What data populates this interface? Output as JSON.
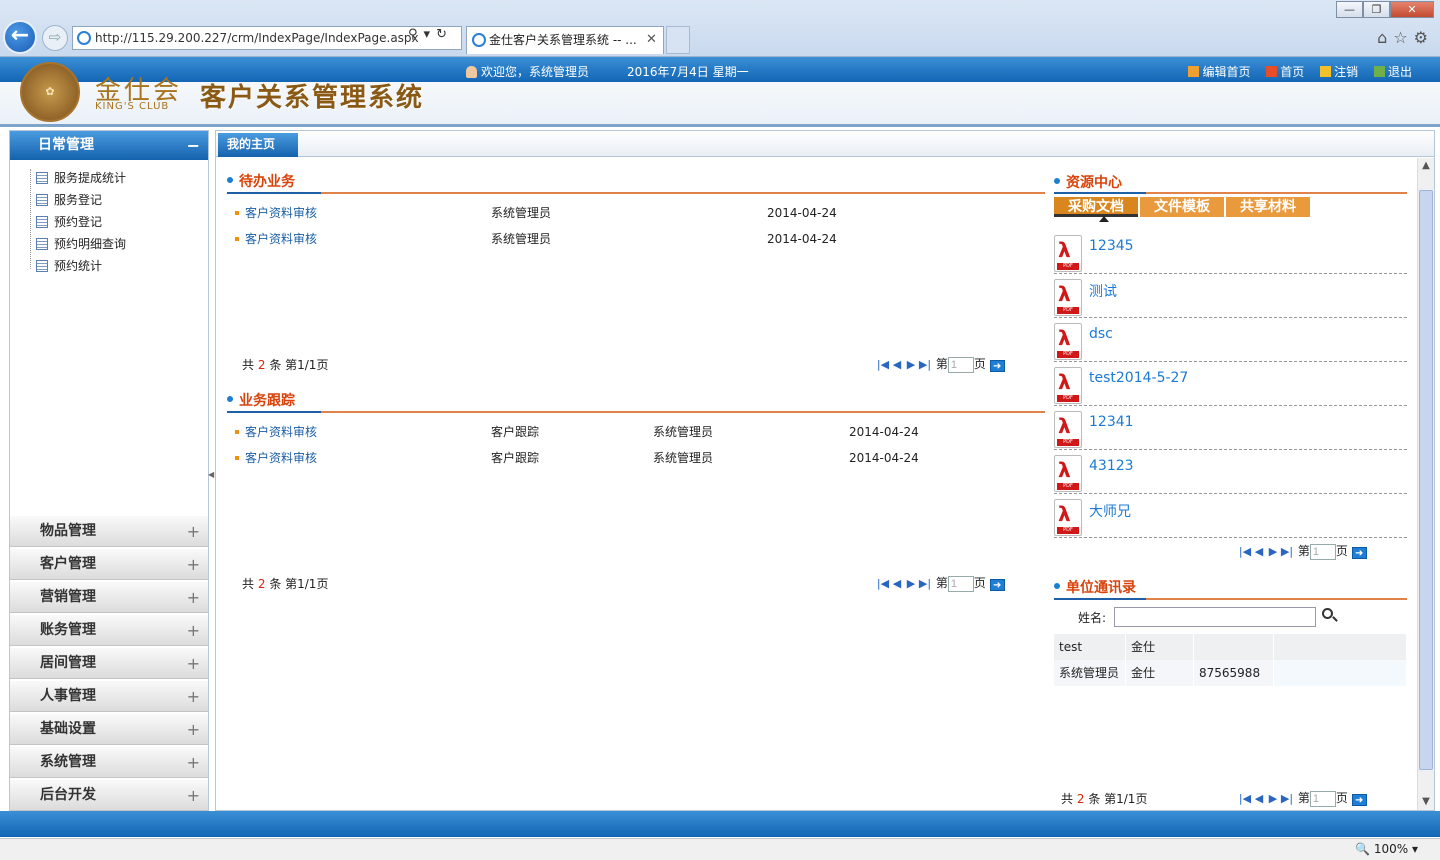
{
  "browser": {
    "url": "http://115.29.200.227/crm/IndexPage/IndexPage.aspx",
    "tab_title": "金仕客户关系管理系统 -- ...",
    "zoom": "100%"
  },
  "header": {
    "logo_cn": "金仕会",
    "logo_en": "KING'S CLUB",
    "system_title": "客户关系管理系统",
    "welcome": "欢迎您，系统管理员",
    "date": "2016年7月4日 星期一",
    "links": [
      "编辑首页",
      "首页",
      "注销",
      "退出"
    ]
  },
  "sidebar": {
    "open_section": "日常管理",
    "open_section_toggle": "−",
    "items": [
      "服务提成统计",
      "服务登记",
      "预约登记",
      "预约明细查询",
      "预约统计"
    ],
    "collapsed_sections": [
      "物品管理",
      "客户管理",
      "营销管理",
      "账务管理",
      "居间管理",
      "人事管理",
      "基础设置",
      "系统管理",
      "后台开发"
    ],
    "expand_symbol": "+"
  },
  "main": {
    "home_tab": "我的主页",
    "pending": {
      "title": "待办业务",
      "rows": [
        {
          "name": "客户资料审核",
          "user": "系统管理员",
          "date": "2014-04-24"
        },
        {
          "name": "客户资料审核",
          "user": "系统管理员",
          "date": "2014-04-24"
        }
      ],
      "pager": {
        "prefix": "共",
        "count": "2",
        "suffix": "条 第1/1页",
        "page_prefix": "第",
        "page_suffix": "页",
        "page_value": "1"
      }
    },
    "tracking": {
      "title": "业务跟踪",
      "rows": [
        {
          "name": "客户资料审核",
          "type": "客户跟踪",
          "user": "系统管理员",
          "date": "2014-04-24"
        },
        {
          "name": "客户资料审核",
          "type": "客户跟踪",
          "user": "系统管理员",
          "date": "2014-04-24"
        }
      ],
      "pager": {
        "prefix": "共",
        "count": "2",
        "suffix": "条 第1/1页",
        "page_prefix": "第",
        "page_suffix": "页",
        "page_value": "1"
      }
    },
    "resources": {
      "title": "资源中心",
      "tabs": [
        "采购文档",
        "文件模板",
        "共享材料"
      ],
      "active_tab": 0,
      "documents": [
        "12345",
        "测试",
        "dsc",
        "test2014-5-27",
        "12341",
        "43123",
        "大师兄"
      ],
      "pdf_label": "PDF",
      "pager": {
        "page_prefix": "第",
        "page_suffix": "页",
        "page_value": "1"
      }
    },
    "contacts": {
      "title": "单位通讯录",
      "search_label": "姓名:",
      "search_value": "",
      "rows": [
        {
          "name": "test",
          "company": "金仕",
          "phone": "",
          "extra": ""
        },
        {
          "name": "系统管理员",
          "company": "金仕",
          "phone": "87565988",
          "extra": ""
        }
      ],
      "pager": {
        "prefix": "共",
        "count": "2",
        "suffix": "条 第1/1页",
        "page_prefix": "第",
        "page_suffix": "页",
        "page_value": "1"
      }
    }
  },
  "colors": {
    "header_blue": "#1366b4",
    "accent_orange": "#d9440c",
    "tab_orange": "#e89a3c",
    "link_blue": "#1c5fa6"
  }
}
